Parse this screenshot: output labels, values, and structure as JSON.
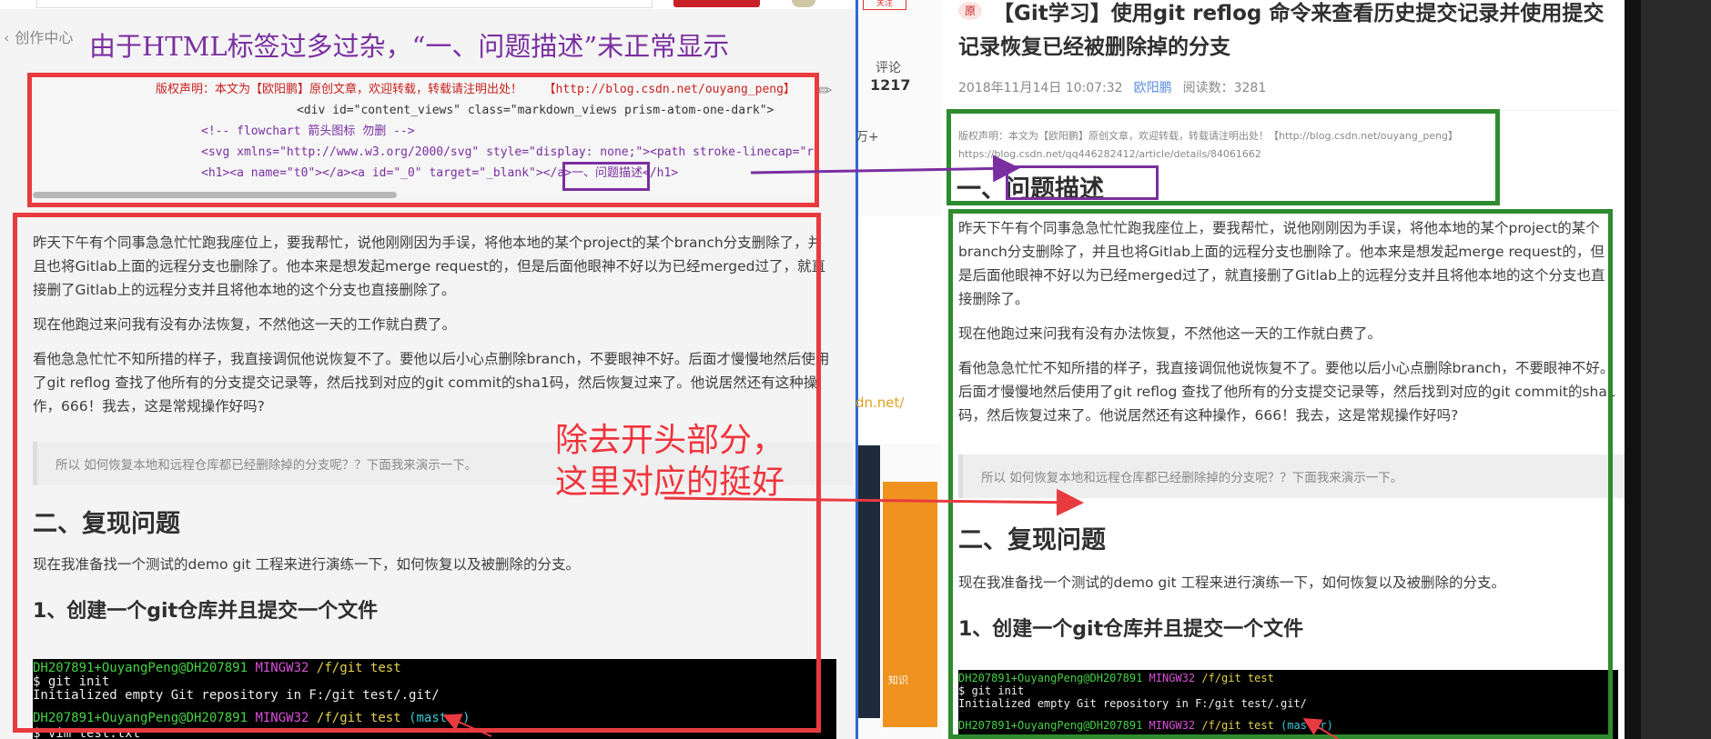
{
  "left": {
    "crumb": "创作中心",
    "annotation_title": "由于HTML标签过多过杂，“一、问题描述”未正常显示",
    "annotation_body": [
      "除去开头部分，",
      "这里对应的挺好"
    ],
    "raw_lines": [
      "版权声明：本文为【欧阳鹏】原创文章，欢迎转载，转载请注明出处！   【http://blog.csdn.net/ouyang_peng】",
      "<div id=\"content_views\" class=\"markdown_views prism-atom-one-dark\">",
      "<!-- flowchart 箭头图标 勿删 -->",
      "<svg xmlns=\"http://www.w3.org/2000/svg\" style=\"display: none;\"><path stroke-linecap=\"r",
      "<h1><a name=\"t0\"></a><a id=\"_0\" target=\"_blank\"></a>一、问题描述</h1>"
    ],
    "paragraphs": [
      "昨天下午有个同事急急忙忙跑我座位上，要我帮忙，说他刚刚因为手误，将他本地的某个project的某个branch分支删除了，并且也将Gitlab上面的远程分支也删除了。他本来是想发起merge request的，但是后面他眼神不好以为已经merged过了，就直接删了Gitlab上的远程分支并且将他本地的这个分支也直接删除了。",
      "现在他跑过来问我有没有办法恢复，不然他这一天的工作就白费了。",
      "看他急急忙忙不知所措的样子，我直接调侃他说恢复不了。要他以后小心点删除branch，不要眼神不好。后面才慢慢地然后使用了git reflog 查找了他所有的分支提交记录等，然后找到对应的git commit的sha1码，然后恢复过来了。他说居然还有这种操作，666！我去，这是常规操作好吗?"
    ],
    "quote": "所以 如何恢复本地和远程仓库都已经删除掉的分支呢？？下面我来演示一下。",
    "h2": "二、复现问题",
    "p_after_h2": "现在我准备找一个测试的demo git 工程来进行演练一下，如何恢复以及被删除的分支。",
    "h3": "1、创建一个git仓库并且提交一个文件",
    "terminal": {
      "user": "DH207891+OuyangPeng@DH207891",
      "env": "MINGW32",
      "path": "/f/git test",
      "branch": "(master)",
      "cmd1": "$ git init",
      "out1": "Initialized empty Git repository in F:/git test/.git/",
      "cmd2": "$ vim test.txt"
    }
  },
  "middle": {
    "follow": "关注",
    "comment_label": "评论",
    "comment_count": "1217",
    "wan": "万+",
    "link_fragment": "dn.net/",
    "orange_label": "知识"
  },
  "right": {
    "badge": "原",
    "title": "【Git学习】使用git reflog 命令来查看历史提交记录并使用提交记录恢复已经被删除掉的分支",
    "date": "2018年11月14日 10:07:32",
    "author": "欧阳鹏",
    "reads": "阅读数：3281",
    "copyright_lines": [
      "版权声明：本文为【欧阳鹏】原创文章，欢迎转载，转载请注明出处！【http://blog.csdn.net/ouyang_peng】",
      "https://blog.csdn.net/qq446282412/article/details/84061662"
    ],
    "h1": "一、问题描述"
  },
  "colors": {
    "annotation_red": "#e83a3f",
    "annotation_green": "#2e8b2e",
    "annotation_purple": "#7a2fa0"
  }
}
